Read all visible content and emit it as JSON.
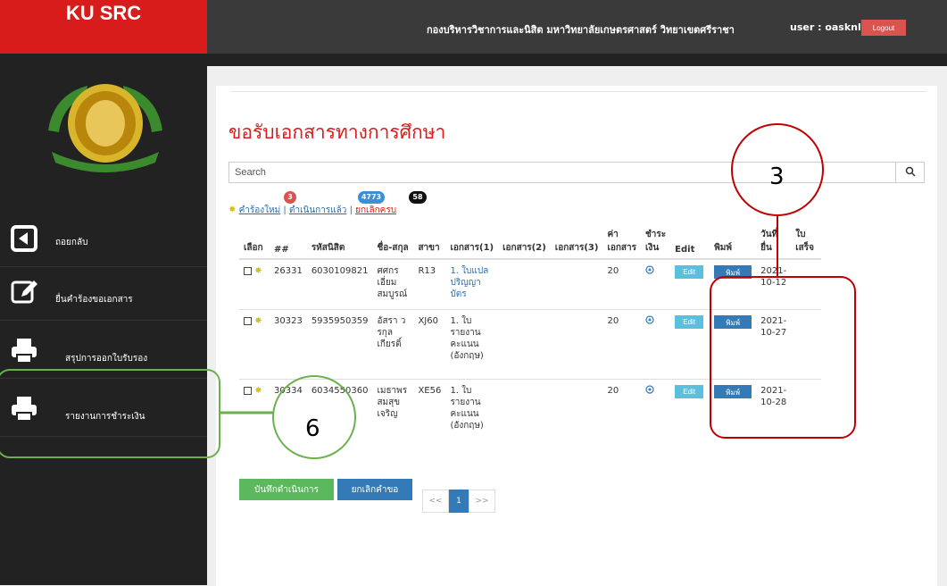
{
  "brand": "KU SRC",
  "header": {
    "org": "กองบริหารวิชาการและนิสิต มหาวิทยาลัยเกษตรศาสตร์ วิทยาเขตศรีราชา",
    "user": "user : oasknl",
    "logout": "Logout"
  },
  "sidebar": {
    "items": [
      {
        "label": "ถอยกลับ",
        "icon": "back-arrow-icon"
      },
      {
        "label": "ยื่นคำร้องขอเอกสาร",
        "icon": "edit-icon"
      },
      {
        "label": "สรุปการออกใบรับรอง",
        "icon": "printer-icon"
      },
      {
        "label": "รายงานการชำระเงิน",
        "icon": "printer-icon"
      }
    ]
  },
  "page": {
    "title": "ขอรับเอกสารทางการศึกษา",
    "search_placeholder": "Search"
  },
  "filters": {
    "new_label": "คำร้องใหม่",
    "new_count": "3",
    "done_label": "ดำเนินการแล้ว",
    "done_count": "4773",
    "cancel_label": "ยกเลิกครบ",
    "cancel_count": "58"
  },
  "table": {
    "headers": [
      "เลือก",
      "##",
      "รหัสนิสิต",
      "ชื่อ-สกุล",
      "สาขา",
      "เอกสาร(1)",
      "เอกสาร(2)",
      "เอกสาร(3)",
      "ค่าเอกสาร",
      "ชำระเงิน",
      "Edit",
      "พิมพ์",
      "วันที่ยื่น",
      "ใบเสร็จ"
    ],
    "rows": [
      {
        "id": "26331",
        "student_id": "6030109821",
        "name": "ศศกร เอี่ยม สมบูรณ์",
        "branch": "R13",
        "doc1": "1. ใบแปลปริญญาบัตร",
        "doc2": "",
        "doc3": "",
        "fee": "20",
        "date": "2021-10-12",
        "edit": "Edit",
        "print": "พิมพ์"
      },
      {
        "id": "30323",
        "student_id": "5935950359",
        "name": "อัสรา วรกุล เกียรติ์",
        "branch": "XJ60",
        "doc1": "1. ใบรายงานคะแนน (อังกฤษ)",
        "doc2": "",
        "doc3": "",
        "fee": "20",
        "date": "2021-10-27",
        "edit": "Edit",
        "print": "พิมพ์"
      },
      {
        "id": "30334",
        "student_id": "6034550360",
        "name": "เมธาพร สมสุข เจริญ",
        "branch": "XE56",
        "doc1": "1. ใบรายงานคะแนน (อังกฤษ)",
        "doc2": "",
        "doc3": "",
        "fee": "20",
        "date": "2021-10-28",
        "edit": "Edit",
        "print": "พิมพ์"
      }
    ]
  },
  "actions": {
    "save": "บันทึกดำเนินการ",
    "cancel": "ยกเลิกคำขอ"
  },
  "pagination": {
    "prev": "<<",
    "page": "1",
    "next": ">>"
  },
  "annotations": {
    "circle_3": "3",
    "circle_6": "6"
  },
  "colors": {
    "accent": "#d81c1c",
    "sidebar": "#222222",
    "annot_red": "#c00000",
    "annot_green": "#6ab04c"
  }
}
